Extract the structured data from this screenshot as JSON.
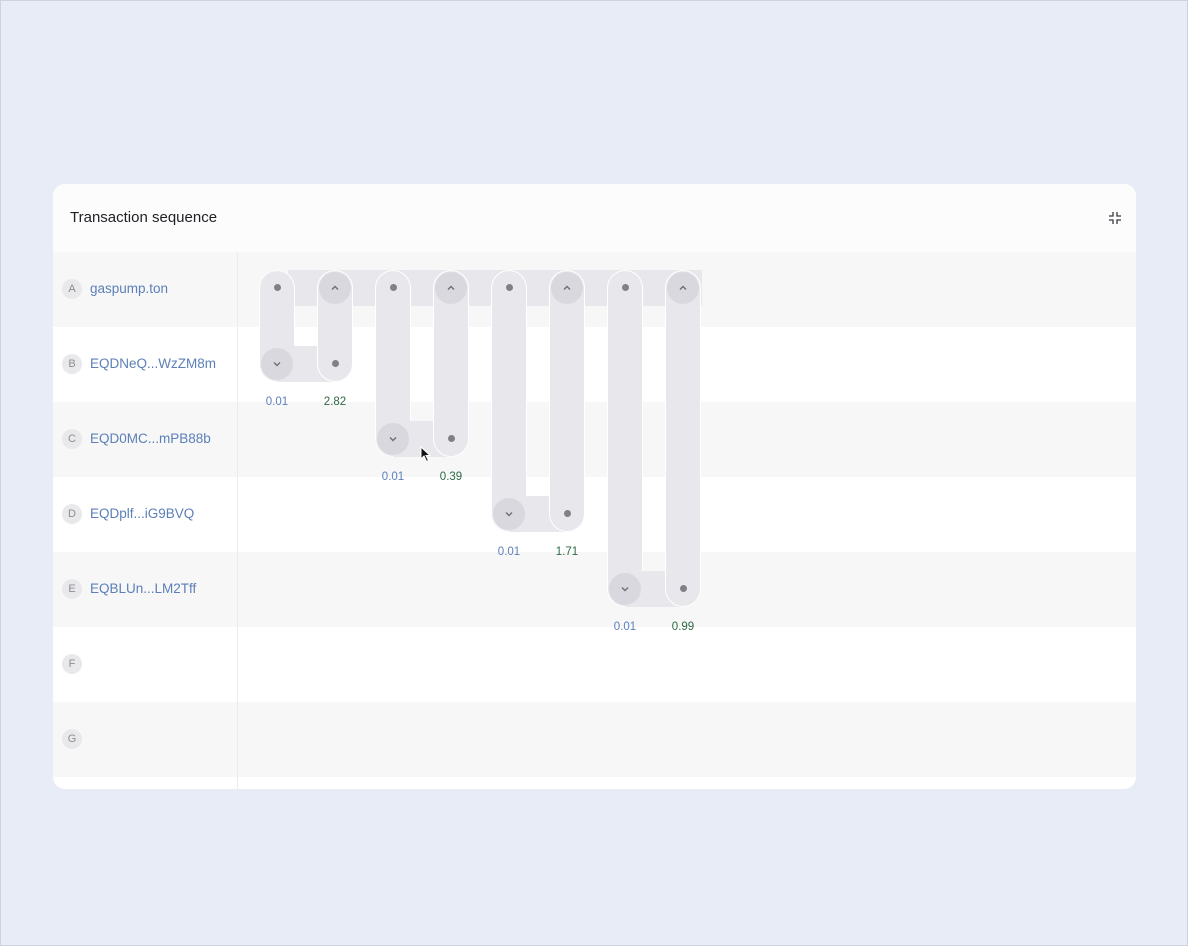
{
  "panel": {
    "title": "Transaction sequence",
    "collapse_icon": "collapse-icon"
  },
  "rows": [
    {
      "letter": "A",
      "address": "gaspump.ton"
    },
    {
      "letter": "B",
      "address": "EQDNeQ...WzZM8m"
    },
    {
      "letter": "C",
      "address": "EQD0MC...mPB88b"
    },
    {
      "letter": "D",
      "address": "EQDplf...iG9BVQ"
    },
    {
      "letter": "E",
      "address": "EQBLUn...LM2Tff"
    },
    {
      "letter": "F",
      "address": ""
    },
    {
      "letter": "G",
      "address": ""
    }
  ],
  "flows": [
    {
      "to_row": "B",
      "fee": "0.01",
      "value": "2.82"
    },
    {
      "to_row": "C",
      "fee": "0.01",
      "value": "0.39"
    },
    {
      "to_row": "D",
      "fee": "0.01",
      "value": "1.71"
    },
    {
      "to_row": "E",
      "fee": "0.01",
      "value": "0.99"
    }
  ],
  "colors": {
    "page_bg": "#e8ecf6",
    "address_link": "#5c7fb8",
    "fee_text": "#5c7fb8",
    "value_text": "#2e6a44",
    "pill": "#e8e7ec"
  }
}
